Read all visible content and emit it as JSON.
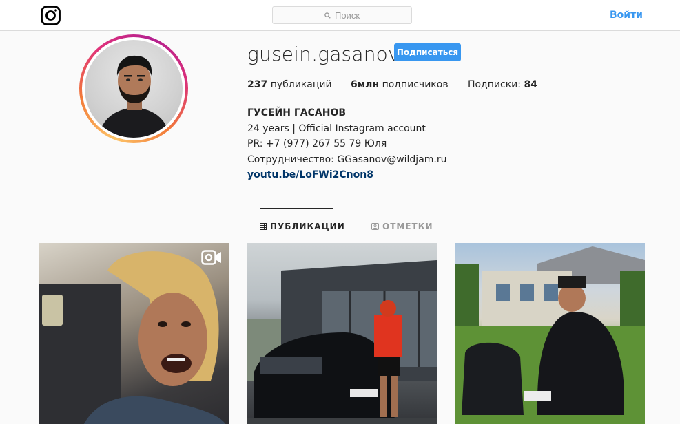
{
  "nav": {
    "search_placeholder": "Поиск",
    "login_label": "Войти"
  },
  "profile": {
    "username": "gusein.gasanov",
    "follow_label": "Подписаться",
    "stats": {
      "posts_count": "237",
      "posts_label": "публикаций",
      "followers_count": "6млн",
      "followers_label": "подписчиков",
      "following_label": "Подписки:",
      "following_count": "84"
    },
    "bio": {
      "full_name": "ГУСЕЙН ГАСАНОВ",
      "line1": "24 years | Official Instagram account",
      "line2": "PR: +7 (977) 267 55 79 Юля",
      "line3": "Сотрудничество: GGasanov@wildjam.ru",
      "link": "youtu.be/LoFWi2Cnon8"
    }
  },
  "tabs": [
    {
      "label": "ПУБЛИКАЦИИ",
      "icon": "grid-icon",
      "active": true
    },
    {
      "label": "ОТМЕТКИ",
      "icon": "tagged-icon",
      "active": false
    }
  ],
  "posts": [
    {
      "type": "video",
      "icon": "video-icon"
    },
    {
      "type": "photo"
    },
    {
      "type": "photo"
    }
  ],
  "colors": {
    "accent": "#3897f0",
    "link": "#003569",
    "border": "#dbdbdb",
    "background": "#fafafa"
  }
}
